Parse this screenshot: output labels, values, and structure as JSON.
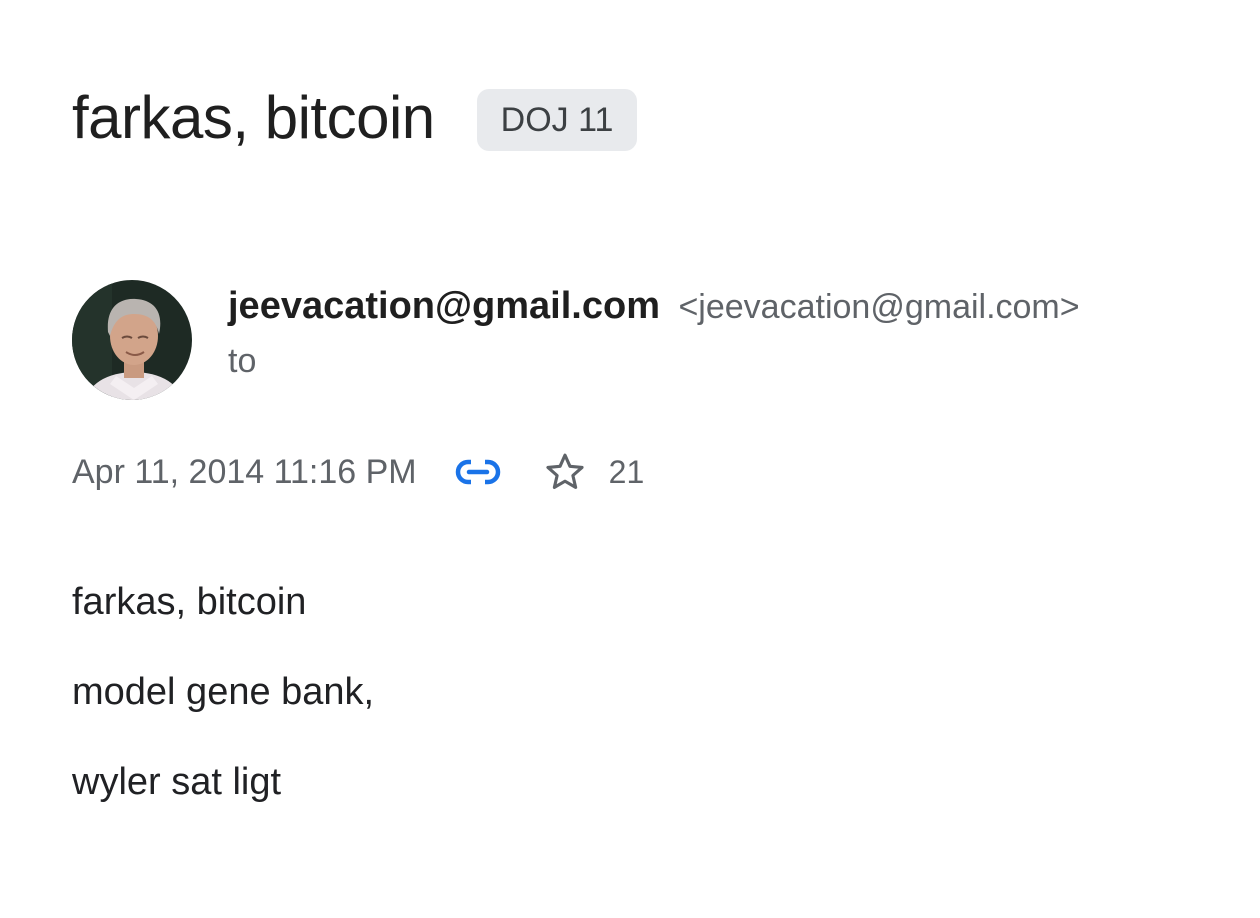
{
  "subject": {
    "title": "farkas, bitcoin",
    "label": "DOJ 11"
  },
  "sender": {
    "display_name": "jeevacation@gmail.com",
    "email": "<jeevacation@gmail.com>",
    "recipient_prefix": "to",
    "avatar_icon": "contact-avatar-photo"
  },
  "meta": {
    "date": "Apr 11, 2014 11:16 PM",
    "link_icon": "link-icon",
    "star_icon": "star-outline-icon",
    "star_count": "21"
  },
  "body": {
    "lines": [
      "farkas, bitcoin",
      "model gene bank,",
      "wyler sat ligt"
    ]
  },
  "colors": {
    "link_icon": "#1a73e8",
    "chip_background": "#e8eaed",
    "secondary_text": "#5f6368"
  }
}
